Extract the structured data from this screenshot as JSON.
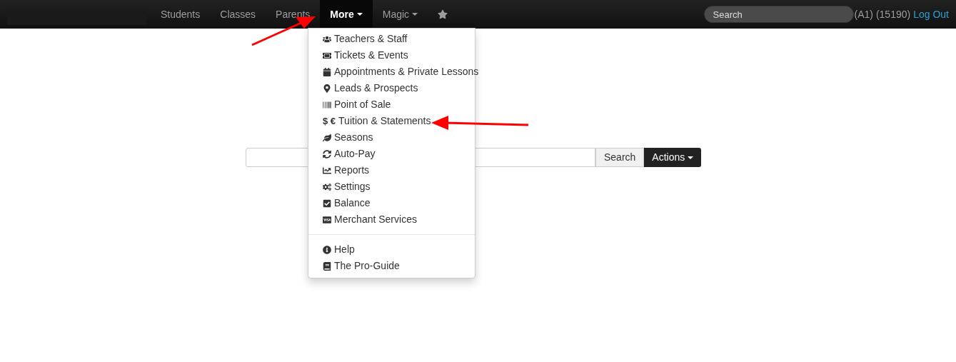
{
  "navbar": {
    "items": [
      {
        "label": "Students",
        "selected": false,
        "kind": "link"
      },
      {
        "label": "Classes",
        "selected": false,
        "kind": "link"
      },
      {
        "label": "Parents",
        "selected": false,
        "kind": "link"
      },
      {
        "label": "More",
        "selected": true,
        "kind": "dropdown"
      },
      {
        "label": "Magic",
        "selected": false,
        "kind": "dropdown"
      },
      {
        "kind": "star",
        "selected": false
      }
    ],
    "search": {
      "placeholder": "Search"
    },
    "account": "(A1) (15190)",
    "logout": "Log Out"
  },
  "dropdown": {
    "groups": [
      [
        {
          "label": "Teachers & Staff"
        },
        {
          "label": "Tickets & Events"
        },
        {
          "label": "Appointments & Private Lessons"
        },
        {
          "label": "Leads & Prospects"
        },
        {
          "label": "Point of Sale"
        },
        {
          "label": "Tuition & Statements",
          "prefix": "$ €"
        },
        {
          "label": "Seasons"
        },
        {
          "label": "Auto-Pay"
        },
        {
          "label": "Reports"
        },
        {
          "label": "Settings"
        },
        {
          "label": "Balance"
        },
        {
          "label": "Merchant Services"
        }
      ],
      [
        {
          "label": "Help"
        },
        {
          "label": "The Pro-Guide"
        }
      ]
    ]
  },
  "search_bar": {
    "button": "Search",
    "actions": "Actions"
  }
}
